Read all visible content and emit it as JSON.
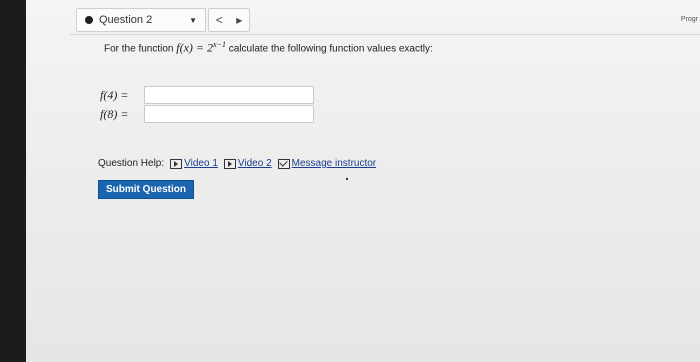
{
  "header": {
    "question_label": "Question 2",
    "nav_left": "<",
    "nav_right": "▸",
    "progress_label": "Progr"
  },
  "question": {
    "prefix": "For the function ",
    "function": "f(x) = 2",
    "exponent": "x−1",
    "suffix": " calculate the following function values exactly:"
  },
  "answers": [
    {
      "label": "f(4) =",
      "value": ""
    },
    {
      "label": "f(8) =",
      "value": ""
    }
  ],
  "help": {
    "label": "Question Help:",
    "links": [
      "Video 1",
      "Video 2",
      "Message instructor"
    ]
  },
  "submit_label": "Submit Question"
}
